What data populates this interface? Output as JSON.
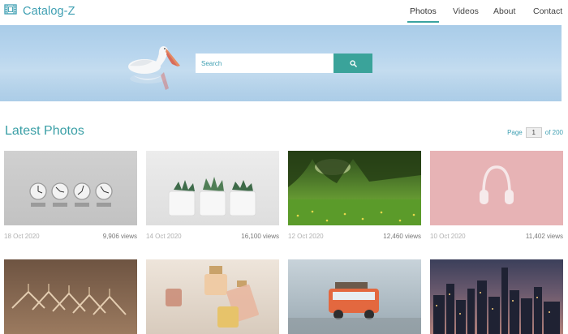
{
  "brand": {
    "name": "Catalog-Z",
    "icon": "film-icon"
  },
  "nav": [
    {
      "label": "Photos",
      "active": true
    },
    {
      "label": "Videos",
      "active": false
    },
    {
      "label": "About",
      "active": false
    },
    {
      "label": "Contact",
      "active": false
    }
  ],
  "hero": {
    "search": {
      "placeholder": "Search",
      "value": ""
    },
    "search_icon": "search-icon"
  },
  "section": {
    "title": "Latest Photos"
  },
  "pager": {
    "prefix": "Page",
    "current": "1",
    "suffix": "of 200"
  },
  "photos": [
    {
      "date": "18 Oct 2020",
      "views": "9,906 views",
      "subject": "world clocks"
    },
    {
      "date": "14 Oct 2020",
      "views": "16,100 views",
      "subject": "potted succulents"
    },
    {
      "date": "12 Oct 2020",
      "views": "12,460 views",
      "subject": "green field trees"
    },
    {
      "date": "10 Oct 2020",
      "views": "11,402 views",
      "subject": "headphones on pink"
    },
    {
      "date": "",
      "views": "",
      "subject": "clothes hangers"
    },
    {
      "date": "",
      "views": "",
      "subject": "perfume bottles"
    },
    {
      "date": "",
      "views": "",
      "subject": "toy bus"
    },
    {
      "date": "",
      "views": "",
      "subject": "city skyline at dusk"
    }
  ],
  "colors": {
    "accent": "#3aa39a",
    "brand": "#3e9fb2"
  }
}
